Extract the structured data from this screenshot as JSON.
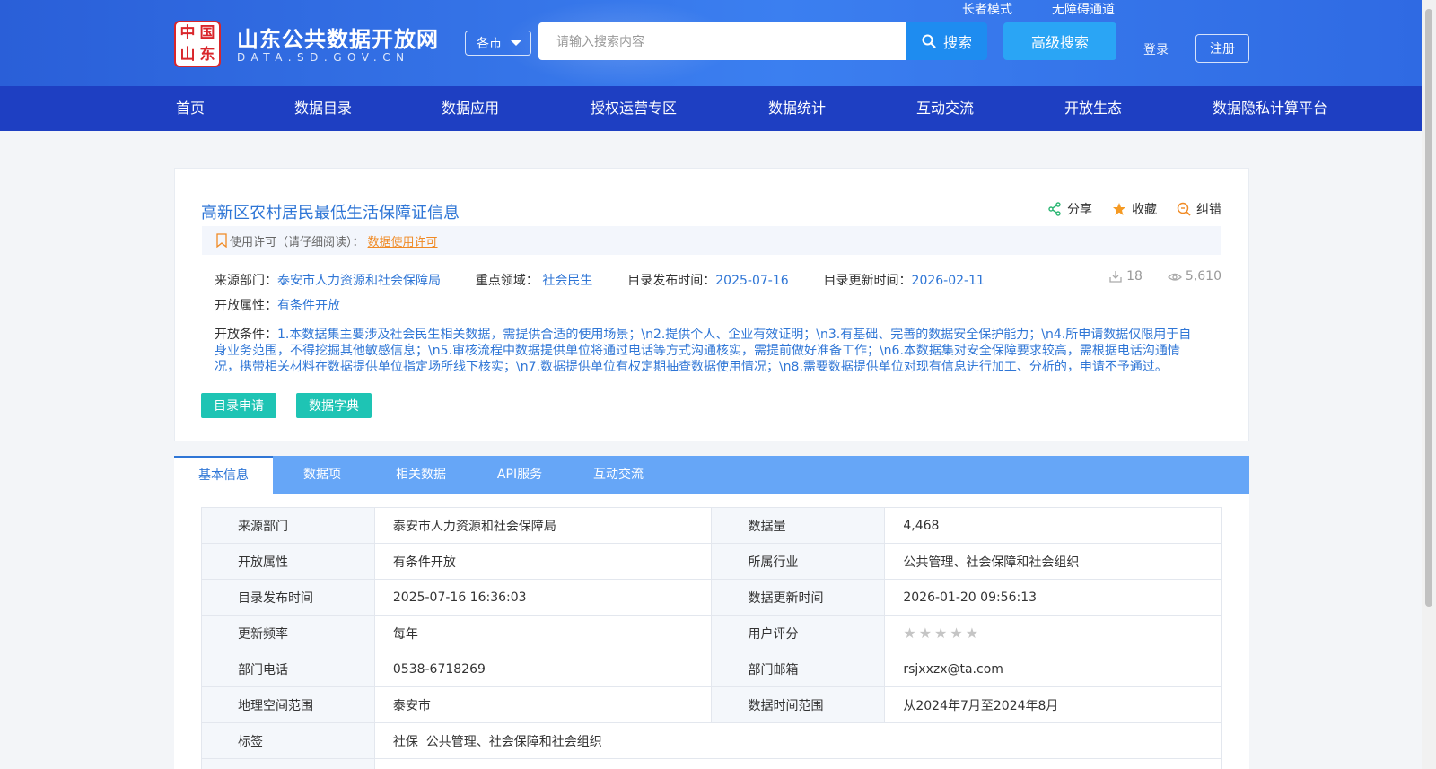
{
  "header": {
    "logo_seal_chars": [
      "中",
      "国",
      "山",
      "东"
    ],
    "site_title": "山东公共数据开放网",
    "site_subtitle": "DATA.SD.GOV.CN",
    "region_select": "各市",
    "search_placeholder": "请输入搜索内容",
    "search_button": "搜索",
    "advanced_search": "高级搜索",
    "elder_mode": "长者模式",
    "accessibility": "无障碍通道",
    "login": "登录",
    "register": "注册"
  },
  "nav": {
    "items": [
      {
        "label": "首页"
      },
      {
        "label": "数据目录"
      },
      {
        "label": "数据应用"
      },
      {
        "label": "授权运营专区"
      },
      {
        "label": "数据统计"
      },
      {
        "label": "互动交流"
      },
      {
        "label": "开放生态"
      },
      {
        "label": "数据隐私计算平台"
      }
    ]
  },
  "dataset": {
    "title": "高新区农村居民最低生活保障证信息",
    "actions": {
      "share": "分享",
      "favorite": "收藏",
      "correct": "纠错"
    },
    "license_label": "使用许可（请仔细阅读）：",
    "license_link": "数据使用许可",
    "source_dept_label": "来源部门：",
    "source_dept": "泰安市人力资源和社会保障局",
    "key_field_label": "重点领域：",
    "key_field": "社会民生",
    "publish_label": "目录发布时间：",
    "publish_date": "2025-07-16",
    "update_label": "目录更新时间：",
    "update_date": "2026-02-11",
    "downloads": "18",
    "views": "5,610",
    "open_attr_label": "开放属性：",
    "open_attr": "有条件开放",
    "conditions_label": "开放条件：",
    "conditions": "1.本数据集主要涉及社会民生相关数据，需提供合适的使用场景；\\n2.提供个人、企业有效证明；\\n3.有基础、完善的数据安全保护能力；\\n4.所申请数据仅限用于自身业务范围，不得挖掘其他敏感信息；\\n5.审核流程中数据提供单位将通过电话等方式沟通核实，需提前做好准备工作；\\n6.本数据集对安全保障要求较高，需根据电话沟通情况，携带相关材料在数据提供单位指定场所线下核实；\\n7.数据提供单位有权定期抽查数据使用情况；\\n8.需要数据提供单位对现有信息进行加工、分析的，申请不予通过。",
    "apply_button": "目录申请",
    "dictionary_button": "数据字典"
  },
  "tabs": [
    {
      "label": "基本信息"
    },
    {
      "label": "数据项"
    },
    {
      "label": "相关数据"
    },
    {
      "label": "API服务"
    },
    {
      "label": "互动交流"
    }
  ],
  "info_table": {
    "rows": [
      {
        "l1": "来源部门",
        "v1": "泰安市人力资源和社会保障局",
        "l2": "数据量",
        "v2": "4,468"
      },
      {
        "l1": "开放属性",
        "v1": "有条件开放",
        "l2": "所属行业",
        "v2": "公共管理、社会保障和社会组织"
      },
      {
        "l1": "目录发布时间",
        "v1": "2025-07-16 16:36:03",
        "l2": "数据更新时间",
        "v2": "2026-01-20 09:56:13"
      },
      {
        "l1": "更新频率",
        "v1": "每年",
        "l2": "用户评分",
        "v2": ""
      },
      {
        "l1": "部门电话",
        "v1": "0538-6718269",
        "l2": "部门邮箱",
        "v2": "rsjxxzx@ta.com"
      },
      {
        "l1": "地理空间范围",
        "v1": "泰安市",
        "l2": "数据时间范围",
        "v2": "从2024年7月至2024年8月"
      }
    ],
    "tags_label": "标签",
    "tags": "社保  公共管理、社会保障和社会组织",
    "rating_stars": 0
  },
  "colors": {
    "header_blue": "#3b7ff0",
    "nav_blue": "#1e3fc2",
    "link_blue": "#2f76d6",
    "accent_teal": "#1ec4b4",
    "license_orange": "#f08a24"
  }
}
